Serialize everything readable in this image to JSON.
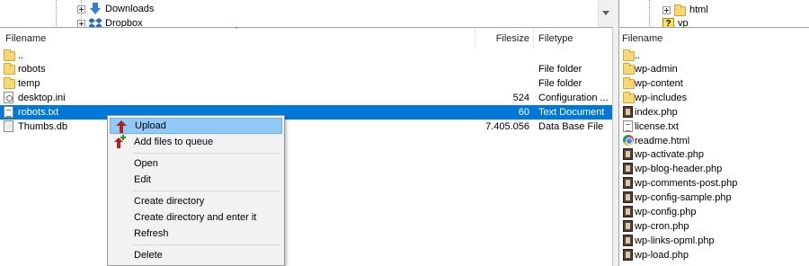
{
  "local_tree": {
    "items": [
      {
        "label": "Downloads",
        "icon": "download-arrow-icon"
      },
      {
        "label": "Dropbox",
        "icon": "dropbox-icon"
      }
    ]
  },
  "remote_tree": {
    "items": [
      {
        "label": "html",
        "icon": "folder-icon"
      },
      {
        "label": "vp",
        "icon": "question-icon"
      }
    ]
  },
  "local_list": {
    "columns": {
      "filename": "Filename",
      "filesize": "Filesize",
      "filetype": "Filetype"
    },
    "rows": [
      {
        "name": "..",
        "size": "",
        "type": "",
        "icon": "folder-icon"
      },
      {
        "name": "robots",
        "size": "",
        "type": "File folder",
        "icon": "folder-icon"
      },
      {
        "name": "temp",
        "size": "",
        "type": "File folder",
        "icon": "folder-icon"
      },
      {
        "name": "desktop.ini",
        "size": "524",
        "type": "Configuration ...",
        "icon": "settings-file-icon"
      },
      {
        "name": "robots.txt",
        "size": "60",
        "type": "Text Document",
        "icon": "text-file-icon",
        "selected": true
      },
      {
        "name": "Thumbs.db",
        "size": "7.405.056",
        "type": "Data Base File",
        "icon": "database-file-icon"
      }
    ]
  },
  "remote_list": {
    "columns": {
      "filename": "Filename"
    },
    "rows": [
      {
        "name": "..",
        "icon": "folder-icon"
      },
      {
        "name": "wp-admin",
        "icon": "folder-icon"
      },
      {
        "name": "wp-content",
        "icon": "folder-icon"
      },
      {
        "name": "wp-includes",
        "icon": "folder-icon"
      },
      {
        "name": "index.php",
        "icon": "php-file-icon"
      },
      {
        "name": "license.txt",
        "icon": "text-file-icon"
      },
      {
        "name": "readme.html",
        "icon": "chrome-icon"
      },
      {
        "name": "wp-activate.php",
        "icon": "php-file-icon"
      },
      {
        "name": "wp-blog-header.php",
        "icon": "php-file-icon"
      },
      {
        "name": "wp-comments-post.php",
        "icon": "php-file-icon"
      },
      {
        "name": "wp-config-sample.php",
        "icon": "php-file-icon"
      },
      {
        "name": "wp-config.php",
        "icon": "php-file-icon"
      },
      {
        "name": "wp-cron.php",
        "icon": "php-file-icon"
      },
      {
        "name": "wp-links-opml.php",
        "icon": "php-file-icon"
      },
      {
        "name": "wp-load.php",
        "icon": "php-file-icon"
      }
    ]
  },
  "context_menu": {
    "items": [
      {
        "label": "Upload",
        "icon": "upload-arrow-icon",
        "highlighted": true
      },
      {
        "label": "Add files to queue",
        "icon": "add-to-queue-icon"
      },
      {
        "label": "Open"
      },
      {
        "label": "Edit"
      },
      {
        "label": "Create directory"
      },
      {
        "label": "Create directory and enter it"
      },
      {
        "label": "Refresh"
      },
      {
        "label": "Delete"
      }
    ]
  },
  "colors": {
    "selection": "#0078d7",
    "menu_highlight": "#91c9f7",
    "folder": "#f8d775"
  }
}
